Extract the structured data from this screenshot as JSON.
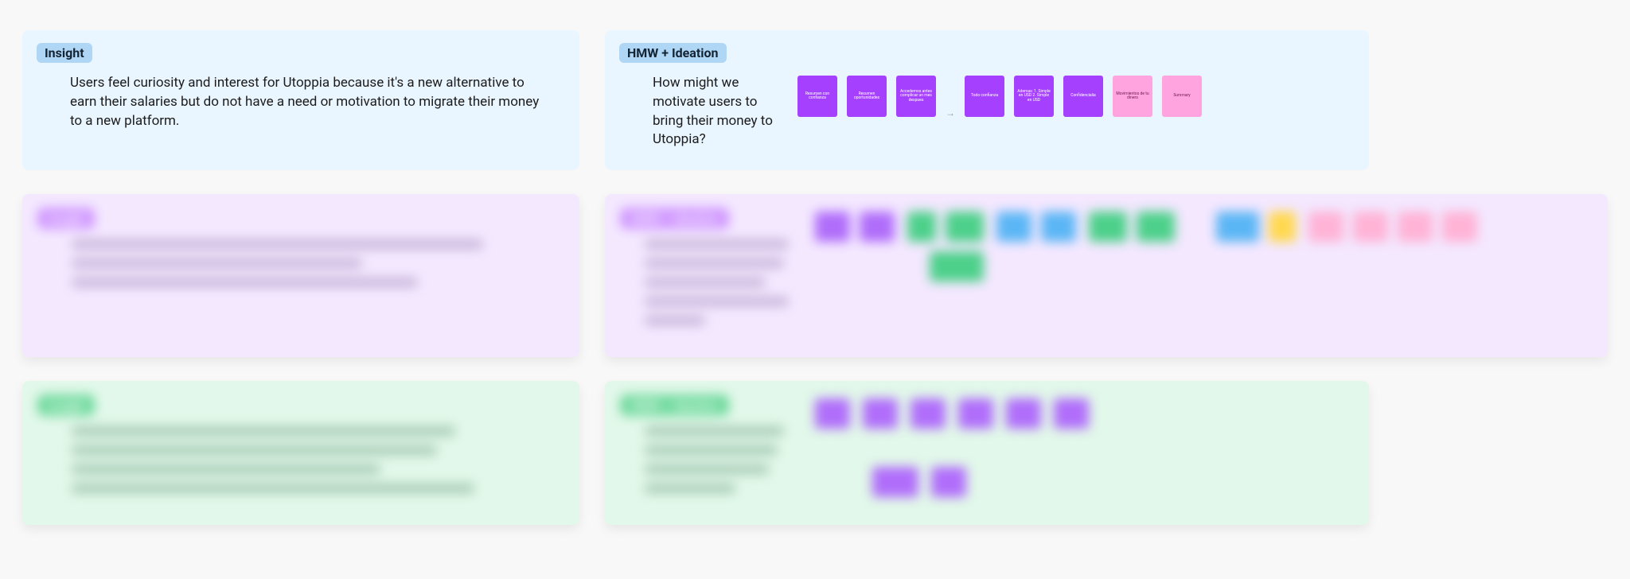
{
  "row1": {
    "insight": {
      "tag": "Insight",
      "body": "Users feel curiosity and interest for Utoppia because it's a new alternative to earn their salaries but do not have a need or motivation to migrate their money to a new platform."
    },
    "hmw": {
      "tag": "HMW + Ideation",
      "question": "How might we motivate users to bring their money to Utoppia?",
      "stickies": [
        {
          "text": "Resumen con confianza",
          "color": "purple"
        },
        {
          "text": "Resumen oportunidades",
          "color": "purple"
        },
        {
          "text": "Accedemos antes complicar un mes despues",
          "color": "purple"
        },
        {
          "arrow": true
        },
        {
          "text": "Todo confianza",
          "color": "purple"
        },
        {
          "text": "Ademas: 1. Simple en USD 2. Simple en USD",
          "color": "purple"
        },
        {
          "text": "Confidencialia",
          "color": "purple"
        },
        {
          "text": "Movimientos de tu dinero",
          "color": "pink"
        },
        {
          "text": "Summary",
          "color": "pink"
        }
      ]
    }
  },
  "row2": {
    "insight_tag": "Insight",
    "hmw_tag": "HMW + Ideation"
  },
  "row3": {
    "insight_tag": "Insight",
    "hmw_tag": "HMW + Ideation"
  }
}
